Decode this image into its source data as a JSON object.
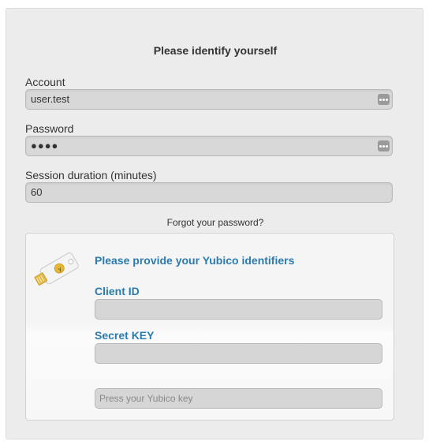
{
  "login": {
    "title": "Please identify yourself",
    "account_label": "Account",
    "account_value": "user.test",
    "password_label": "Password",
    "password_value": "●●●●",
    "session_label": "Session duration (minutes)",
    "session_value": "60",
    "forgot_link": "Forgot your password?"
  },
  "yubico": {
    "heading": "Please provide your Yubico identifiers",
    "client_id_label": "Client ID",
    "client_id_value": "",
    "secret_key_label": "Secret KEY",
    "secret_key_value": "",
    "key_placeholder": "Press your Yubico key",
    "logo_icon": "yubikey-icon"
  },
  "colors": {
    "accent": "#2a7bb0",
    "panel_bg": "#ececec",
    "field_bg": "#d8d8d8"
  }
}
